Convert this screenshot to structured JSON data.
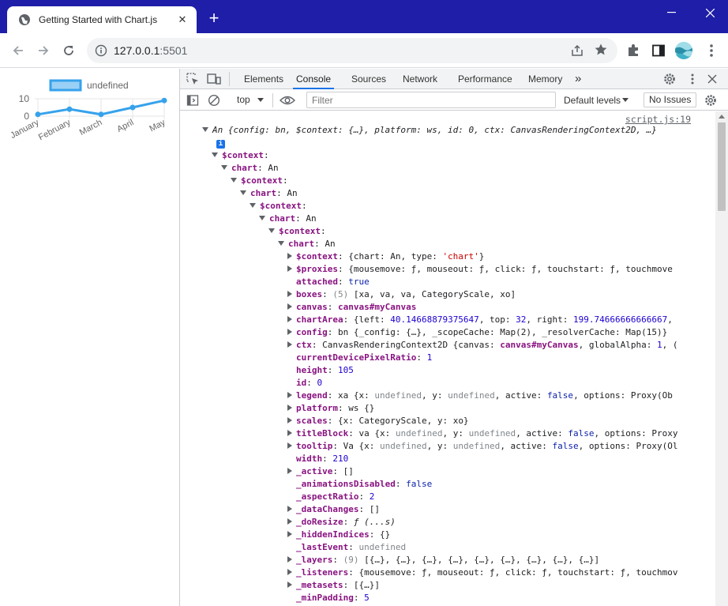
{
  "browser": {
    "tab_title": "Getting Started with Chart.js",
    "url_host": "127.0.0.1",
    "url_port": ":5501"
  },
  "devtools": {
    "tabs": [
      "Elements",
      "Console",
      "Sources",
      "Network",
      "Performance",
      "Memory"
    ],
    "active_tab": "Console",
    "more": "»",
    "context": "top",
    "filter_placeholder": "Filter",
    "levels": "Default levels",
    "issues": "No Issues",
    "source_link": "script.js:19"
  },
  "chart_data": {
    "type": "line",
    "categories": [
      "January",
      "February",
      "March",
      "April",
      "May"
    ],
    "series": [
      {
        "name": "undefined",
        "values": [
          1,
          4,
          1,
          5,
          9
        ],
        "color": "#36a2eb"
      }
    ],
    "legend_label": "undefined",
    "yticks": [
      "10",
      "0"
    ],
    "ylim": [
      0,
      10
    ],
    "legend": "top",
    "grid": true
  },
  "console_lines": [
    {
      "i": 0,
      "arrow": "down",
      "parts": [
        [
          "ital v",
          "An {"
        ],
        [
          "ital v",
          "config: bn, $context: {…}, platform: ws, id: 0, ctx: CanvasRenderingContext2D, …}"
        ]
      ]
    },
    {
      "i": 0,
      "arrow": "none",
      "badge": true,
      "parts": []
    },
    {
      "i": 1,
      "arrow": "down",
      "parts": [
        [
          "key",
          "$context"
        ],
        [
          "v",
          ":"
        ]
      ]
    },
    {
      "i": 2,
      "arrow": "down",
      "parts": [
        [
          "key",
          "chart"
        ],
        [
          "v",
          ": An"
        ]
      ]
    },
    {
      "i": 3,
      "arrow": "down",
      "parts": [
        [
          "key",
          "$context"
        ],
        [
          "v",
          ":"
        ]
      ]
    },
    {
      "i": 4,
      "arrow": "down",
      "parts": [
        [
          "key",
          "chart"
        ],
        [
          "v",
          ": An"
        ]
      ]
    },
    {
      "i": 5,
      "arrow": "down",
      "parts": [
        [
          "key",
          "$context"
        ],
        [
          "v",
          ":"
        ]
      ]
    },
    {
      "i": 6,
      "arrow": "down",
      "parts": [
        [
          "key",
          "chart"
        ],
        [
          "v",
          ": An"
        ]
      ]
    },
    {
      "i": 7,
      "arrow": "down",
      "parts": [
        [
          "key",
          "$context"
        ],
        [
          "v",
          ":"
        ]
      ]
    },
    {
      "i": 8,
      "arrow": "down",
      "parts": [
        [
          "key",
          "chart"
        ],
        [
          "v",
          ": An"
        ]
      ]
    },
    {
      "i": 9,
      "arrow": "right",
      "parts": [
        [
          "key",
          "$context"
        ],
        [
          "v",
          ": {chart: An, type: "
        ],
        [
          "str",
          "'chart'"
        ],
        [
          "v",
          "}"
        ]
      ]
    },
    {
      "i": 9,
      "arrow": "right",
      "parts": [
        [
          "key",
          "$proxies"
        ],
        [
          "v",
          ": {mousemove: ƒ, mouseout: ƒ, click: ƒ, touchstart: ƒ, touchmove"
        ]
      ]
    },
    {
      "i": 9,
      "arrow": "none",
      "parts": [
        [
          "key",
          "attached"
        ],
        [
          "v",
          ": "
        ],
        [
          "kw",
          "true"
        ]
      ]
    },
    {
      "i": 9,
      "arrow": "right",
      "parts": [
        [
          "key",
          "boxes"
        ],
        [
          "v",
          ": "
        ],
        [
          "muted",
          "(5)"
        ],
        [
          "v",
          " [xa, va, va, CategoryScale, xo]"
        ]
      ]
    },
    {
      "i": 9,
      "arrow": "right",
      "parts": [
        [
          "key",
          "canvas"
        ],
        [
          "v",
          ": "
        ],
        [
          "key plain",
          "canvas#myCanvas"
        ]
      ]
    },
    {
      "i": 9,
      "arrow": "right",
      "parts": [
        [
          "key",
          "chartArea"
        ],
        [
          "v",
          ": {left: "
        ],
        [
          "num",
          "40.14668879375647"
        ],
        [
          "v",
          ", top: "
        ],
        [
          "num",
          "32"
        ],
        [
          "v",
          ", right: "
        ],
        [
          "num",
          "199.74666666666667"
        ],
        [
          "v",
          ","
        ]
      ]
    },
    {
      "i": 9,
      "arrow": "right",
      "parts": [
        [
          "key",
          "config"
        ],
        [
          "v",
          ": bn {_config: {…}, _scopeCache: Map(2), _resolverCache: Map(15)}"
        ]
      ]
    },
    {
      "i": 9,
      "arrow": "right",
      "parts": [
        [
          "key",
          "ctx"
        ],
        [
          "v",
          ": CanvasRenderingContext2D {canvas: "
        ],
        [
          "key plain",
          "canvas#myCanvas"
        ],
        [
          "v",
          ", globalAlpha: "
        ],
        [
          "num",
          "1"
        ],
        [
          "v",
          ", ("
        ]
      ]
    },
    {
      "i": 9,
      "arrow": "none",
      "parts": [
        [
          "key",
          "currentDevicePixelRatio"
        ],
        [
          "v",
          ": "
        ],
        [
          "num",
          "1"
        ]
      ]
    },
    {
      "i": 9,
      "arrow": "none",
      "parts": [
        [
          "key",
          "height"
        ],
        [
          "v",
          ": "
        ],
        [
          "num",
          "105"
        ]
      ]
    },
    {
      "i": 9,
      "arrow": "none",
      "parts": [
        [
          "key",
          "id"
        ],
        [
          "v",
          ": "
        ],
        [
          "num",
          "0"
        ]
      ]
    },
    {
      "i": 9,
      "arrow": "right",
      "parts": [
        [
          "key",
          "legend"
        ],
        [
          "v",
          ": xa {x: "
        ],
        [
          "muted",
          "undefined"
        ],
        [
          "v",
          ", y: "
        ],
        [
          "muted",
          "undefined"
        ],
        [
          "v",
          ", active: "
        ],
        [
          "kw",
          "false"
        ],
        [
          "v",
          ", options: Proxy(Ob"
        ]
      ]
    },
    {
      "i": 9,
      "arrow": "right",
      "parts": [
        [
          "key",
          "platform"
        ],
        [
          "v",
          ": ws {}"
        ]
      ]
    },
    {
      "i": 9,
      "arrow": "right",
      "parts": [
        [
          "key",
          "scales"
        ],
        [
          "v",
          ": {x: CategoryScale, y: xo}"
        ]
      ]
    },
    {
      "i": 9,
      "arrow": "right",
      "parts": [
        [
          "key",
          "titleBlock"
        ],
        [
          "v",
          ": va {x: "
        ],
        [
          "muted",
          "undefined"
        ],
        [
          "v",
          ", y: "
        ],
        [
          "muted",
          "undefined"
        ],
        [
          "v",
          ", active: "
        ],
        [
          "kw",
          "false"
        ],
        [
          "v",
          ", options: Proxy"
        ]
      ]
    },
    {
      "i": 9,
      "arrow": "right",
      "parts": [
        [
          "key",
          "tooltip"
        ],
        [
          "v",
          ": Va {x: "
        ],
        [
          "muted",
          "undefined"
        ],
        [
          "v",
          ", y: "
        ],
        [
          "muted",
          "undefined"
        ],
        [
          "v",
          ", active: "
        ],
        [
          "kw",
          "false"
        ],
        [
          "v",
          ", options: Proxy(Ol"
        ]
      ]
    },
    {
      "i": 9,
      "arrow": "none",
      "parts": [
        [
          "key",
          "width"
        ],
        [
          "v",
          ": "
        ],
        [
          "num",
          "210"
        ]
      ]
    },
    {
      "i": 9,
      "arrow": "right",
      "parts": [
        [
          "key",
          "_active"
        ],
        [
          "v",
          ": []"
        ]
      ]
    },
    {
      "i": 9,
      "arrow": "none",
      "parts": [
        [
          "key",
          "_animationsDisabled"
        ],
        [
          "v",
          ": "
        ],
        [
          "kw",
          "false"
        ]
      ]
    },
    {
      "i": 9,
      "arrow": "none",
      "parts": [
        [
          "key",
          "_aspectRatio"
        ],
        [
          "v",
          ": "
        ],
        [
          "num",
          "2"
        ]
      ]
    },
    {
      "i": 9,
      "arrow": "right",
      "parts": [
        [
          "key",
          "_dataChanges"
        ],
        [
          "v",
          ": []"
        ]
      ]
    },
    {
      "i": 9,
      "arrow": "right",
      "parts": [
        [
          "key",
          "_doResize"
        ],
        [
          "v",
          ": "
        ],
        [
          "ital v",
          "ƒ (...s)"
        ]
      ]
    },
    {
      "i": 9,
      "arrow": "right",
      "parts": [
        [
          "key",
          "_hiddenIndices"
        ],
        [
          "v",
          ": {}"
        ]
      ]
    },
    {
      "i": 9,
      "arrow": "none",
      "parts": [
        [
          "key",
          "_lastEvent"
        ],
        [
          "v",
          ": "
        ],
        [
          "muted",
          "undefined"
        ]
      ]
    },
    {
      "i": 9,
      "arrow": "right",
      "parts": [
        [
          "key",
          "_layers"
        ],
        [
          "v",
          ": "
        ],
        [
          "muted",
          "(9)"
        ],
        [
          "v",
          " [{…}, {…}, {…}, {…}, {…}, {…}, {…}, {…}, {…}]"
        ]
      ]
    },
    {
      "i": 9,
      "arrow": "right",
      "parts": [
        [
          "key",
          "_listeners"
        ],
        [
          "v",
          ": {mousemove: ƒ, mouseout: ƒ, click: ƒ, touchstart: ƒ, touchmov"
        ]
      ]
    },
    {
      "i": 9,
      "arrow": "right",
      "parts": [
        [
          "key",
          "_metasets"
        ],
        [
          "v",
          ": [{…}]"
        ]
      ]
    },
    {
      "i": 9,
      "arrow": "none",
      "parts": [
        [
          "key",
          "_minPadding"
        ],
        [
          "v",
          ": "
        ],
        [
          "num",
          "5"
        ]
      ]
    }
  ]
}
